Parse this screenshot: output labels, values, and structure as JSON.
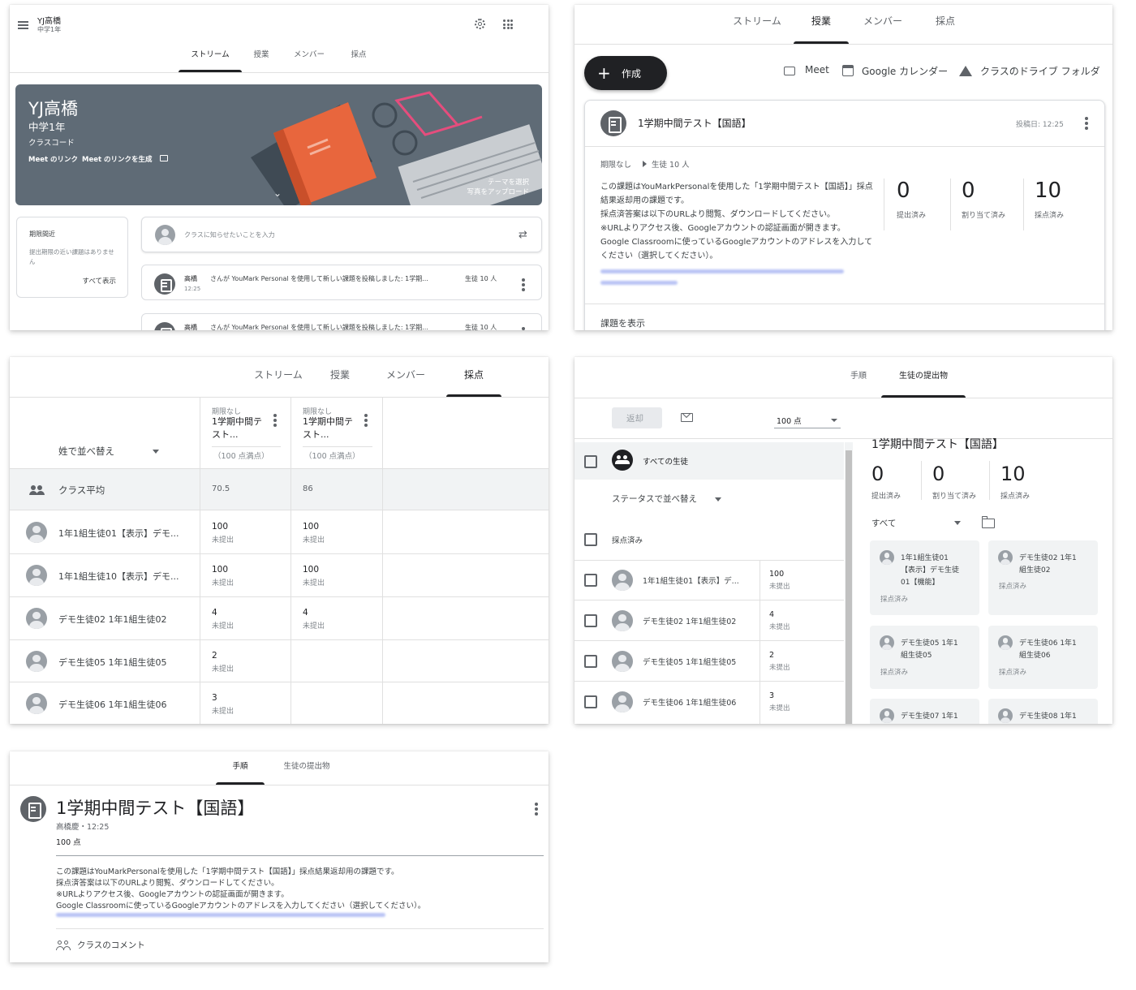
{
  "p1": {
    "class_name": "YJ高橋",
    "class_section": "中学1年",
    "tabs": [
      "ストリーム",
      "授業",
      "メンバー",
      "採点"
    ],
    "banner": {
      "title": "YJ高橋",
      "subtitle": "中学1年",
      "class_code_label": "クラスコード",
      "meet_label": "Meet のリンク",
      "meet_link": "Meet のリンクを生成",
      "theme_select": "テーマを選択",
      "upload_photo": "写真をアップロード"
    },
    "upcoming": {
      "title": "期限間近",
      "empty": "提出期限の近い課題はありません",
      "view_all": "すべて表示"
    },
    "announce_placeholder": "クラスに知らせたいことを入力",
    "posts": [
      {
        "author": "高橋",
        "text": "さんが YouMark Personal を使用して新しい課題を投稿しました: 1学期...",
        "audience": "生徒 10 人",
        "time": "12:25"
      },
      {
        "author": "高橋",
        "text": "さんが YouMark Personal を使用して新しい課題を投稿しました: 1学期...",
        "audience": "生徒 10 人"
      }
    ]
  },
  "p2": {
    "tabs": [
      "ストリーム",
      "授業",
      "メンバー",
      "採点"
    ],
    "create_label": "作成",
    "meet_label": "Meet",
    "calendar_label": "Google カレンダー",
    "drive_label": "クラスのドライブ フォルダ",
    "assignment": {
      "title": "1学期中間テスト【国語】",
      "posted": "投稿日: 12:25",
      "due": "期限なし",
      "audience": "生徒 10 人",
      "description": "この課題はYouMarkPersonalを使用した「1学期中間テスト【国語】」採点結果返却用の課題です。\n採点済答案は以下のURLより閲覧、ダウンロードしてください。\n※URLよりアクセス後、Googleアカウントの認証画面が開きます。\nGoogle Classroomに使っているGoogleアカウントのアドレスを入力してください（選択してください）。",
      "stats": [
        {
          "value": "0",
          "label": "提出済み"
        },
        {
          "value": "0",
          "label": "割り当て済み"
        },
        {
          "value": "10",
          "label": "採点済み"
        }
      ],
      "view_link": "課題を表示"
    }
  },
  "p3": {
    "tabs": [
      "ストリーム",
      "授業",
      "メンバー",
      "採点"
    ],
    "sort_label": "姓で並べ替え",
    "columns": [
      {
        "due": "期限なし",
        "title": "1学期中間テスト...",
        "points": "（100 点満点）"
      },
      {
        "due": "期限なし",
        "title": "1学期中間テスト...",
        "points": "（100 点満点）"
      }
    ],
    "class_avg_label": "クラス平均",
    "class_avg": [
      "70.5",
      "86"
    ],
    "rows": [
      {
        "name": "1年1組生徒01【表示】デモ...",
        "grades": [
          {
            "score": "100",
            "status": "未提出"
          },
          {
            "score": "100",
            "status": "未提出"
          }
        ]
      },
      {
        "name": "1年1組生徒10【表示】デモ...",
        "grades": [
          {
            "score": "100",
            "status": "未提出"
          },
          {
            "score": "100",
            "status": "未提出"
          }
        ]
      },
      {
        "name": "デモ生徒02 1年1組生徒02",
        "grades": [
          {
            "score": "4",
            "status": "未提出"
          },
          {
            "score": "4",
            "status": "未提出"
          }
        ]
      },
      {
        "name": "デモ生徒05 1年1組生徒05",
        "grades": [
          {
            "score": "2",
            "status": "未提出"
          }
        ]
      },
      {
        "name": "デモ生徒06 1年1組生徒06",
        "grades": [
          {
            "score": "3",
            "status": "未提出"
          }
        ]
      }
    ]
  },
  "p4": {
    "tabs": [
      "手順",
      "生徒の提出物"
    ],
    "return_label": "返却",
    "points_select": "100 点",
    "all_students": "すべての生徒",
    "status_sort": "ステータスで並べ替え",
    "graded_label": "採点済み",
    "students": [
      {
        "name": "1年1組生徒01【表示】デ...",
        "score": "100",
        "status": "未提出"
      },
      {
        "name": "デモ生徒02 1年1組生徒02",
        "score": "4",
        "status": "未提出"
      },
      {
        "name": "デモ生徒05 1年1組生徒05",
        "score": "2",
        "status": "未提出"
      },
      {
        "name": "デモ生徒06 1年1組生徒06",
        "score": "3",
        "status": "未提出"
      }
    ],
    "assignment_title": "1学期中間テスト【国語】",
    "stats": [
      {
        "value": "0",
        "label": "提出済み"
      },
      {
        "value": "0",
        "label": "割り当て済み"
      },
      {
        "value": "10",
        "label": "採点済み"
      }
    ],
    "filter": "すべて",
    "cards": [
      {
        "line1": "1年1組生徒01",
        "line2": "【表示】デモ生徒",
        "line3": "01【機能】",
        "status": "採点済み"
      },
      {
        "line1": "デモ生徒02 1年1",
        "line2": "組生徒02",
        "line3": "",
        "status": "採点済み"
      },
      {
        "line1": "デモ生徒05 1年1",
        "line2": "組生徒05",
        "line3": "",
        "status": "採点済み"
      },
      {
        "line1": "デモ生徒06 1年1",
        "line2": "組生徒06",
        "line3": "",
        "status": "採点済み"
      },
      {
        "line1": "デモ生徒07 1年1",
        "line2": "",
        "line3": "",
        "status": ""
      },
      {
        "line1": "デモ生徒08 1年1",
        "line2": "",
        "line3": "",
        "status": ""
      }
    ]
  },
  "p5": {
    "tabs": [
      "手順",
      "生徒の提出物"
    ],
    "title": "1学期中間テスト【国語】",
    "meta": "高橋慶・12:25",
    "points": "100 点",
    "desc_lines": [
      "この課題はYouMarkPersonalを使用した「1学期中間テスト【国語】」採点結果返却用の課題です。",
      "採点済答案は以下のURLより閲覧、ダウンロードしてください。",
      "※URLよりアクセス後、Googleアカウントの認証画面が開きます。",
      "Google Classroomに使っているGoogleアカウントのアドレスを入力してください（選択してください）。"
    ],
    "class_comments": "クラスのコメント"
  },
  "colors": {
    "banner": "#5f6b76",
    "book": "#e8663d",
    "glasses": "#e54d7d",
    "create_button": "#202124"
  }
}
